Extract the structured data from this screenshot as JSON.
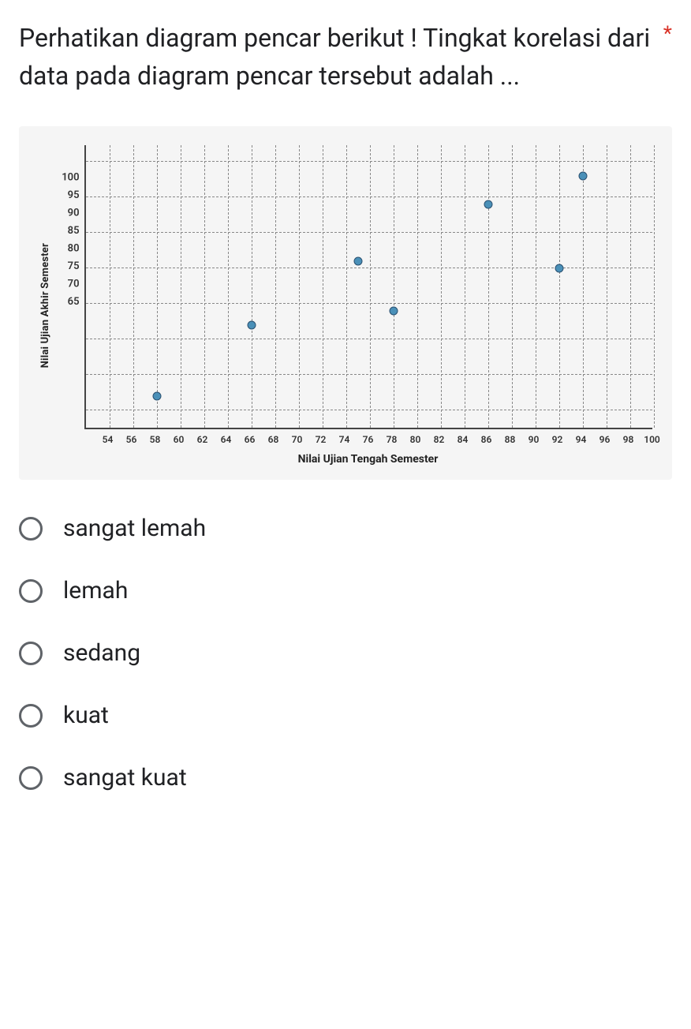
{
  "question": {
    "text": "Perhatikan diagram pencar berikut !\nTingkat korelasi dari data pada diagram pencar tersebut adalah ...",
    "required_mark": "*"
  },
  "chart_data": {
    "type": "scatter",
    "title": "",
    "xlabel": "Nilai Ujian Tengah Semester",
    "ylabel": "Nilai Ujian Akhir Semester",
    "xlim": [
      52,
      100
    ],
    "ylim": [
      62.5,
      102.5
    ],
    "xticks": [
      54,
      56,
      58,
      60,
      62,
      64,
      66,
      68,
      70,
      72,
      74,
      76,
      78,
      80,
      82,
      84,
      86,
      88,
      90,
      92,
      94,
      96,
      98,
      100
    ],
    "yticks": [
      65,
      70,
      75,
      80,
      85,
      90,
      95,
      100
    ],
    "points": [
      {
        "x": 58,
        "y": 67
      },
      {
        "x": 66,
        "y": 77
      },
      {
        "x": 75,
        "y": 86
      },
      {
        "x": 78,
        "y": 79
      },
      {
        "x": 86,
        "y": 94
      },
      {
        "x": 92,
        "y": 85
      },
      {
        "x": 94,
        "y": 98
      }
    ]
  },
  "options": [
    {
      "label": "sangat lemah"
    },
    {
      "label": "lemah"
    },
    {
      "label": "sedang"
    },
    {
      "label": "kuat"
    },
    {
      "label": "sangat kuat"
    }
  ]
}
